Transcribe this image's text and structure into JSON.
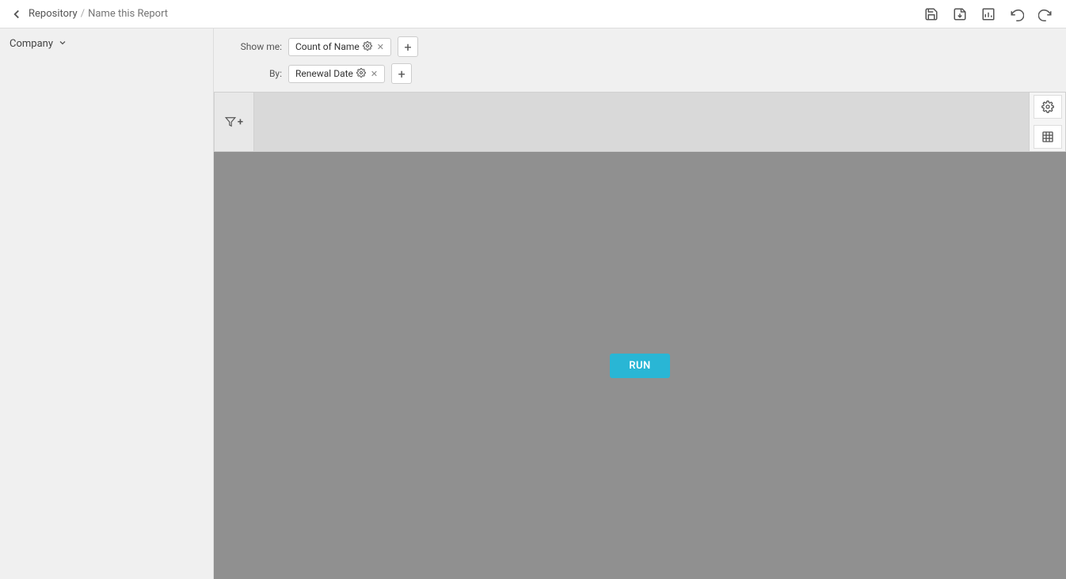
{
  "topbar": {
    "back_label": "←",
    "breadcrumb_repo": "Repository",
    "breadcrumb_sep": "/",
    "report_name_placeholder": "Name this Report",
    "icons": {
      "save": "💾",
      "export": "📤",
      "chart": "📊",
      "undo": "↺",
      "redo": "↻"
    }
  },
  "left_panel": {
    "company_label": "Company",
    "chevron": "▼"
  },
  "controls": {
    "show_me_label": "Show me:",
    "by_label": "By:",
    "show_me_pill": "Count of Name",
    "by_pill": "Renewal Date",
    "add_label": "+"
  },
  "filter": {
    "icon": "⊿",
    "add_label": "+"
  },
  "right_icons": {
    "gear": "⚙",
    "table": "▦"
  },
  "data_area": {
    "run_label": "RUN"
  }
}
